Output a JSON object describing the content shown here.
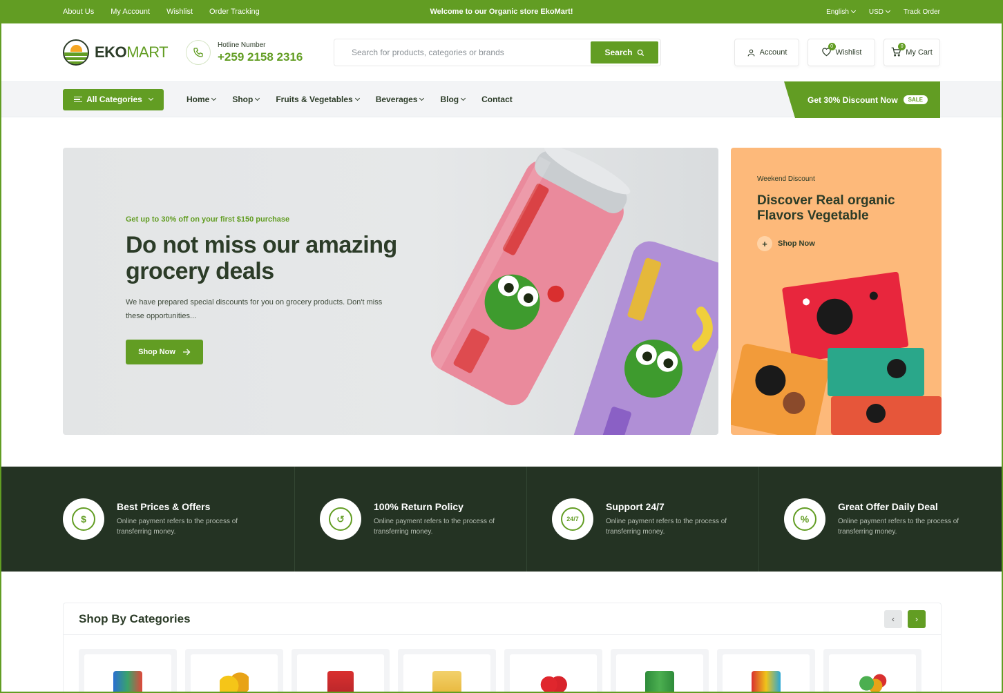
{
  "topbar": {
    "links": [
      "About Us",
      "My Account",
      "Wishlist",
      "Order Tracking"
    ],
    "welcome": "Welcome to our Organic store EkoMart!",
    "language": "English",
    "currency": "USD",
    "track_order": "Track Order"
  },
  "header": {
    "logo_part1": "EKO",
    "logo_part2": "MART",
    "hotline_label": "Hotline Number",
    "hotline_number": "+259 2158 2316",
    "search_placeholder": "Search for products, categories or brands",
    "search_button": "Search",
    "account": "Account",
    "wishlist": "Wishlist",
    "wishlist_count": "0",
    "cart": "My Cart",
    "cart_count": "0"
  },
  "nav": {
    "all_categories": "All Categories",
    "items": [
      {
        "label": "Home",
        "dropdown": true
      },
      {
        "label": "Shop",
        "dropdown": true
      },
      {
        "label": "Fruits & Vegetables",
        "dropdown": true
      },
      {
        "label": "Beverages",
        "dropdown": true
      },
      {
        "label": "Blog",
        "dropdown": true
      },
      {
        "label": "Contact",
        "dropdown": false
      }
    ],
    "promo": "Get 30% Discount Now",
    "promo_badge": "SALE"
  },
  "hero": {
    "kicker": "Get up to 30% off on your first $150 purchase",
    "title": "Do not miss our amazing grocery deals",
    "text": "We have prepared special discounts for you on grocery products. Don't miss these opportunities...",
    "button": "Shop Now"
  },
  "side_banner": {
    "tag": "Weekend Discount",
    "title": "Discover Real organic Flavors Vegetable",
    "button": "Shop Now"
  },
  "features": [
    {
      "title": "Best Prices & Offers",
      "text": "Online payment refers to the process of transferring money.",
      "icon": "dollar-icon",
      "glyph": "$"
    },
    {
      "title": "100% Return Policy",
      "text": "Online payment refers to the process of transferring money.",
      "icon": "return-icon",
      "glyph": "↺"
    },
    {
      "title": "Support 24/7",
      "text": "Online payment refers to the process of transferring money.",
      "icon": "support-icon",
      "glyph": "24/7"
    },
    {
      "title": "Great Offer Daily Deal",
      "text": "Online payment refers to the process of transferring money.",
      "icon": "discount-icon",
      "glyph": "%"
    }
  ],
  "categories": {
    "title": "Shop By Categories"
  },
  "colors": {
    "brand": "#629d23",
    "dark": "#243323",
    "hero_bg": "#e3e5e6",
    "side_bg": "#fdb97a"
  }
}
